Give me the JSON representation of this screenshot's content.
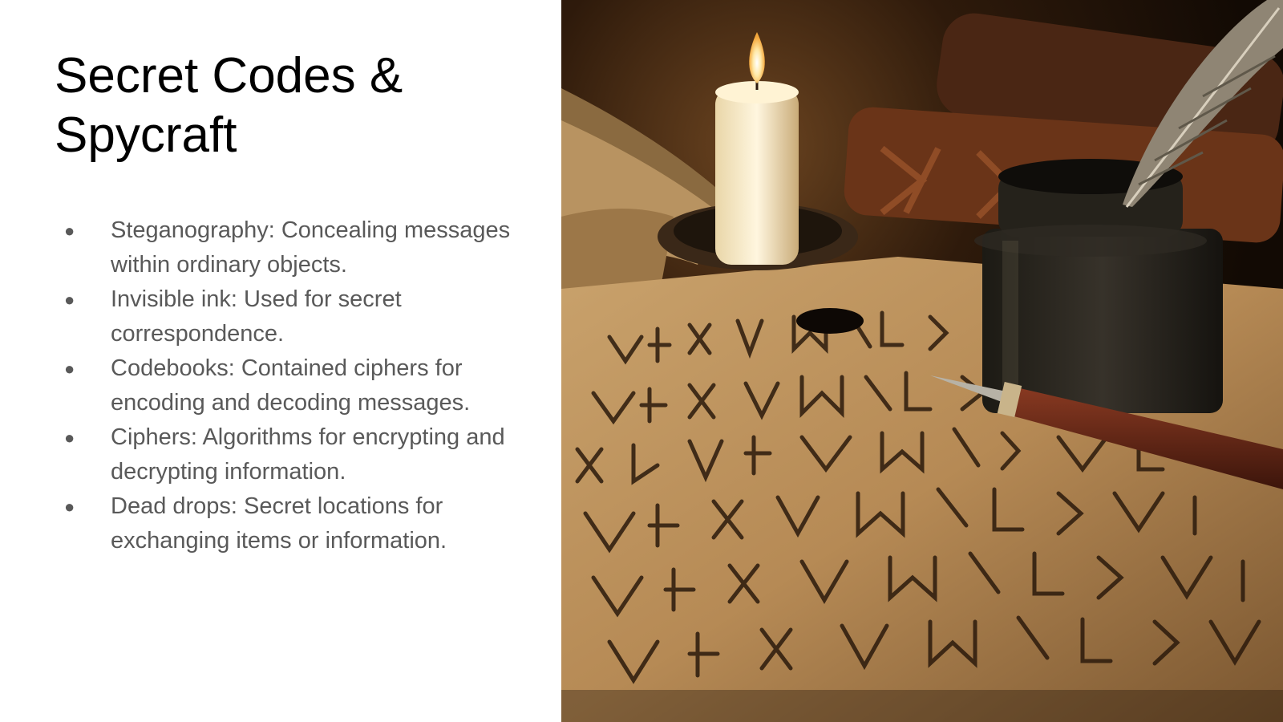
{
  "slide": {
    "title": "Secret Codes & Spycraft",
    "bullets": [
      {
        "text": "Steganography: Concealing messages within ordinary objects."
      },
      {
        "text": "Invisible ink: Used for secret correspondence."
      },
      {
        "text": "Codebooks: Contained ciphers for encoding and decoding messages."
      },
      {
        "text": "Ciphers:  Algorithms for encrypting and decrypting information."
      },
      {
        "text": "Dead drops: Secret locations for exchanging items or information."
      }
    ],
    "bullet_symbol": "●"
  },
  "colors": {
    "title": "#000000",
    "body_text": "#595959",
    "background": "#ffffff"
  },
  "image": {
    "subject": "candle, ink bottle with quill pen and runic cipher parchment on a wooden desk"
  }
}
